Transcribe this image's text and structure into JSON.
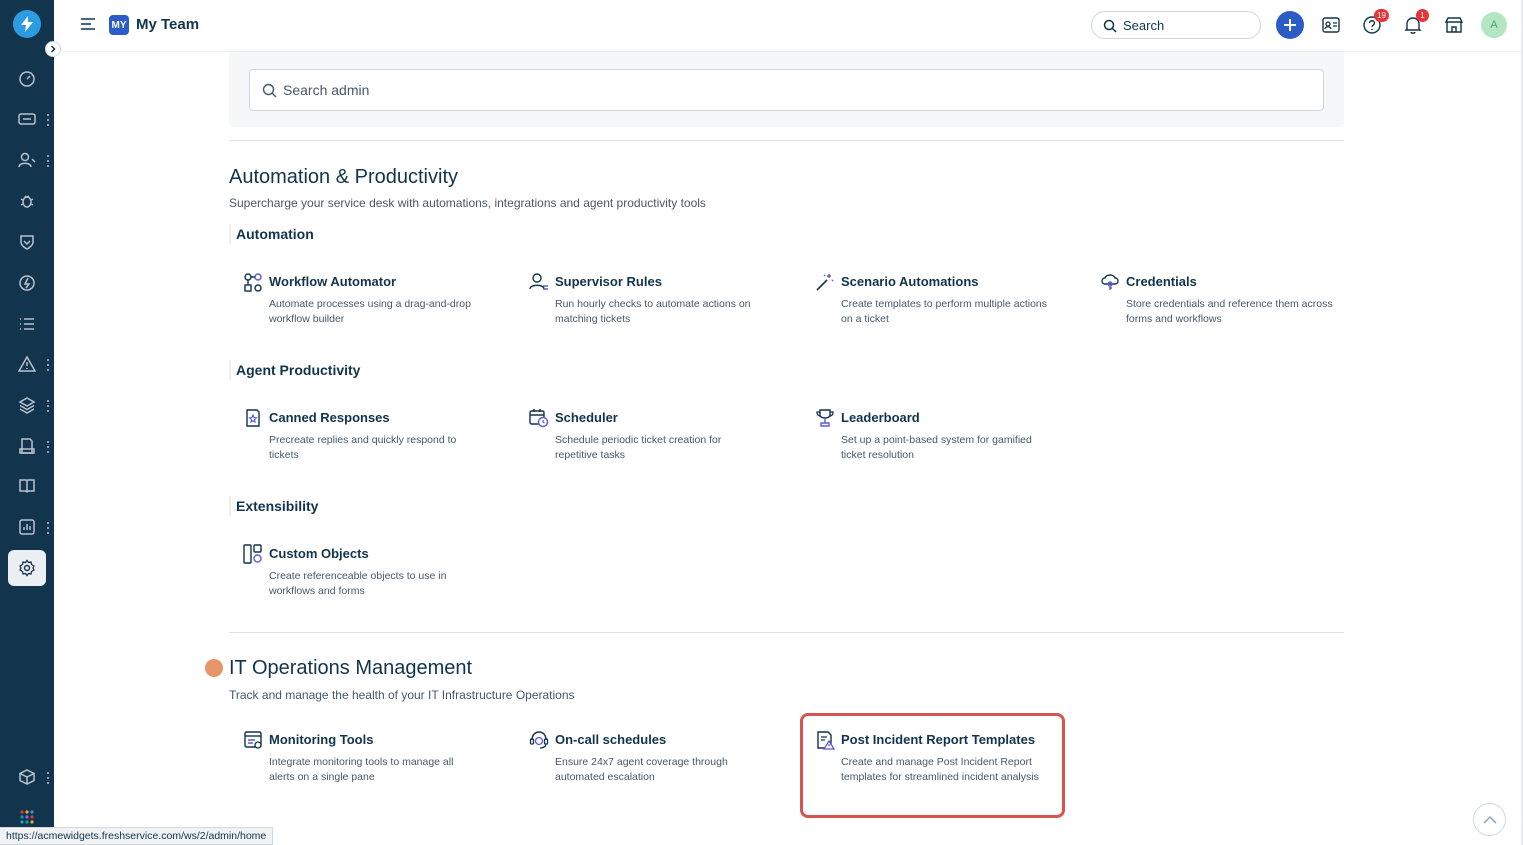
{
  "app": {
    "workspace_initials": "MY",
    "workspace_name": "My Team"
  },
  "topbar": {
    "search_placeholder": "Search",
    "help_badge": "19",
    "notification_badge": "1",
    "avatar_initial": "A"
  },
  "admin_search": {
    "placeholder": "Search admin"
  },
  "automation_section": {
    "title": "Automation & Productivity",
    "description": "Supercharge your service desk with automations, integrations and agent productivity tools",
    "groups": [
      {
        "heading": "Automation",
        "items": [
          {
            "title": "Workflow Automator",
            "desc": "Automate processes using a drag-and-drop workflow builder",
            "icon": "workflow-icon"
          },
          {
            "title": "Supervisor Rules",
            "desc": "Run hourly checks to automate actions on matching tickets",
            "icon": "supervisor-icon"
          },
          {
            "title": "Scenario Automations",
            "desc": "Create templates to perform multiple actions on a ticket",
            "icon": "magic-wand-icon"
          },
          {
            "title": "Credentials",
            "desc": "Store credentials and reference them across forms and workflows",
            "icon": "credentials-icon"
          }
        ]
      },
      {
        "heading": "Agent Productivity",
        "items": [
          {
            "title": "Canned Responses",
            "desc": "Precreate replies and quickly respond to tickets",
            "icon": "canned-response-icon"
          },
          {
            "title": "Scheduler",
            "desc": "Schedule periodic ticket creation for repetitive tasks",
            "icon": "calendar-clock-icon"
          },
          {
            "title": "Leaderboard",
            "desc": "Set up a point-based system for gamified ticket resolution",
            "icon": "trophy-icon"
          }
        ]
      },
      {
        "heading": "Extensibility",
        "items": [
          {
            "title": "Custom Objects",
            "desc": "Create referenceable objects to use in workflows and forms",
            "icon": "custom-objects-icon"
          }
        ]
      }
    ]
  },
  "itom_section": {
    "title": "IT Operations Management",
    "description": "Track and manage the health of your IT Infrastructure Operations",
    "items": [
      {
        "title": "Monitoring Tools",
        "desc": "Integrate monitoring tools to manage all alerts on a single pane",
        "icon": "monitoring-icon"
      },
      {
        "title": "On-call schedules",
        "desc": "Ensure 24x7 agent coverage through automated escalation",
        "icon": "on-call-icon"
      },
      {
        "title": "Post Incident Report Templates",
        "desc": "Create and manage Post Incident Report templates for streamlined incident analysis",
        "icon": "report-template-icon"
      }
    ]
  },
  "status_url": "https://acmewidgets.freshservice.com/ws/2/admin/home",
  "colors": {
    "rail": "#12344d",
    "primary": "#2c5cc5",
    "highlight": "#d9534f",
    "icon_purple": "#5b5bd6"
  }
}
